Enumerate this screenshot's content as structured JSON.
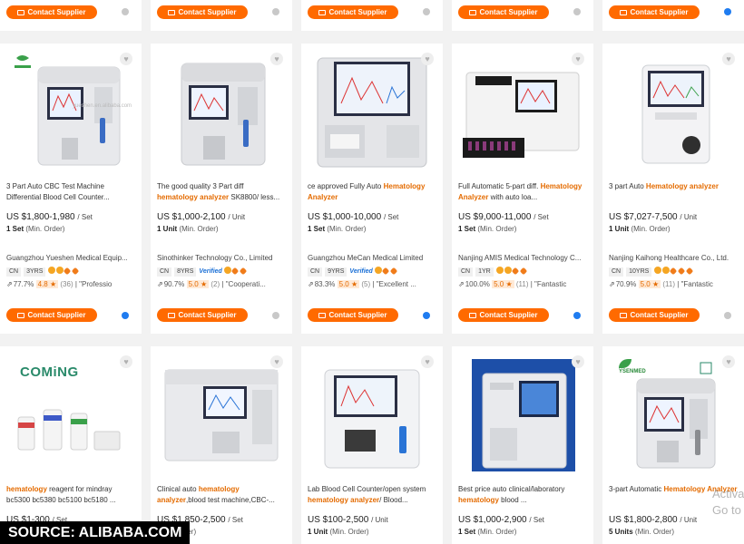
{
  "contact_label": "Contact Supplier",
  "top_row": [
    {
      "online": false
    },
    {
      "online": false
    },
    {
      "online": false
    },
    {
      "online": false
    },
    {
      "online": true
    }
  ],
  "middle_row": [
    {
      "title_pre": "3 Part Auto CBC Test Machine Differential Blood Cell Counter...",
      "title_hl": "",
      "title_post": "",
      "price": "US $1,800-1,980",
      "unit": "/ Set",
      "moq_qty": "1 Set",
      "moq_note": "(Min. Order)",
      "supplier": "Guangzhou Yueshen Medical Equip...",
      "country": "CN",
      "years": "3YRS",
      "verified": "",
      "rate": "77.7%",
      "score": "4.8",
      "reviews": "(36)",
      "tag": "\"Professio",
      "online": true
    },
    {
      "title_pre": "The good quality 3 Part diff ",
      "title_hl": "hematology analyzer",
      "title_post": " SK8800/ less...",
      "price": "US $1,000-2,100",
      "unit": "/ Unit",
      "moq_qty": "1 Unit",
      "moq_note": "(Min. Order)",
      "supplier": "Sinothinker Technology Co., Limited",
      "country": "CN",
      "years": "8YRS",
      "verified": "Verified",
      "rate": "90.7%",
      "score": "5.0",
      "reviews": "(2)",
      "tag": "\"Cooperati...",
      "online": false
    },
    {
      "title_pre": "ce approved Fully Auto ",
      "title_hl": "Hematology Analyzer",
      "title_post": "",
      "price": "US $1,000-10,000",
      "unit": "/ Set",
      "moq_qty": "1 Set",
      "moq_note": "(Min. Order)",
      "supplier": "Guangzhou MeCan Medical Limited",
      "country": "CN",
      "years": "9YRS",
      "verified": "Verified",
      "rate": "83.3%",
      "score": "5.0",
      "reviews": "(5)",
      "tag": "\"Excellent ...",
      "online": true
    },
    {
      "title_pre": "Full Automatic 5-part diff. ",
      "title_hl": "Hematology Analyzer",
      "title_post": " with auto loa...",
      "price": "US $9,000-11,000",
      "unit": "/ Set",
      "moq_qty": "1 Set",
      "moq_note": "(Min. Order)",
      "supplier": "Nanjing AMIS Medical Technology C...",
      "country": "CN",
      "years": "1YR",
      "verified": "",
      "rate": "100.0%",
      "score": "5.0",
      "reviews": "(11)",
      "tag": "\"Fantastic",
      "online": true
    },
    {
      "title_pre": "3 part Auto ",
      "title_hl": "Hematology analyzer",
      "title_post": "",
      "price": "US $7,027-7,500",
      "unit": "/ Unit",
      "moq_qty": "1 Unit",
      "moq_note": "(Min. Order)",
      "supplier": "Nanjing Kaihong Healthcare Co., Ltd.",
      "country": "CN",
      "years": "10YRS",
      "verified": "",
      "rate": "70.9%",
      "score": "5.0",
      "reviews": "(11)",
      "tag": "\"Fantastic",
      "online": false
    }
  ],
  "bottom_row": [
    {
      "title_hl": "hematology",
      "title_post": " reagent for mindray bc5300 bc5380 bc5100 bc5180 ...",
      "price": "US $1-300",
      "unit": "/ Set",
      "moq": ""
    },
    {
      "title_pre": "Clinical auto ",
      "title_hl": "hematology analyzer",
      "title_post": ",blood test machine,CBC-...",
      "price": "US $1,850-2,500",
      "unit": "/ Set",
      "moq": "(Min. Order)"
    },
    {
      "title_pre": "Lab Blood Cell Counter/open system ",
      "title_hl": "hematology analyzer",
      "title_post": "/ Blood...",
      "price": "US $100-2,500",
      "unit": "/ Unit",
      "moq_qty": "1 Unit",
      "moq_note": "(Min. Order)"
    },
    {
      "title_pre": "Best price auto clinical/laboratory ",
      "title_hl": "hematology",
      "title_post": " blood ...",
      "price": "US $1,000-2,900",
      "unit": "/ Set",
      "moq_qty": "1 Set",
      "moq_note": "(Min. Order)"
    },
    {
      "title_pre": "3-part Automatic ",
      "title_hl": "Hematology Analyzer",
      "title_post": "",
      "price": "US $1,800-2,800",
      "unit": "/ Unit",
      "moq_qty": "5 Units",
      "moq_note": "(Min. Order)"
    }
  ],
  "logos": {
    "coming": "COMiNG",
    "yeshen": "YSENMED"
  },
  "watermark": {
    "line1": "Activate",
    "line2": "Go to Setti"
  },
  "source": "SOURCE: ALIBABA.COM"
}
